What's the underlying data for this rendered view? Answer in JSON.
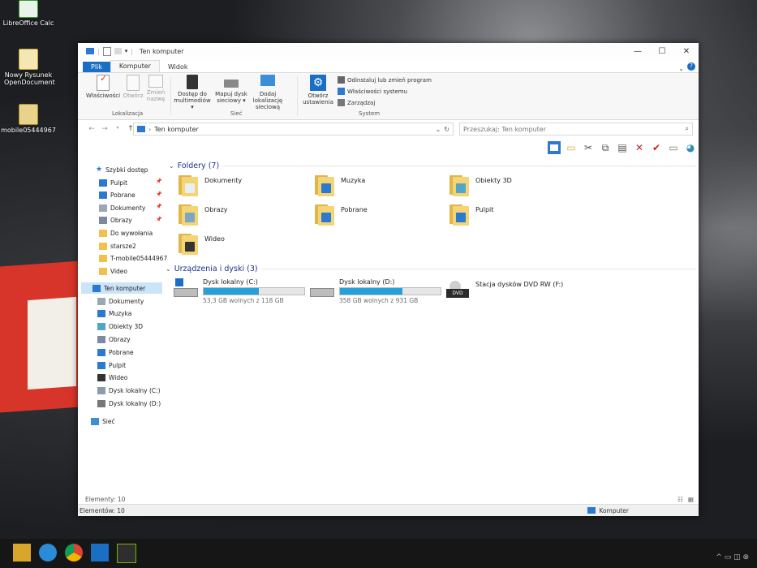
{
  "desktop": {
    "icons": [
      {
        "label": "LibreOffice Calc",
        "icon": "spreadsheet-icon"
      },
      {
        "label": "Nowy Rysunek OpenDocument",
        "icon": "drawing-icon"
      },
      {
        "label": "mobile05444967",
        "icon": "archive-icon"
      }
    ]
  },
  "window": {
    "title": "Ten komputer",
    "tabs": [
      "Plik",
      "Komputer",
      "Widok"
    ],
    "ribbon": {
      "location_group": "Lokalizacja",
      "network_group": "Sieć",
      "system_group": "System",
      "properties": "Właściwości",
      "open": "Otwórz",
      "rename": "Zmień nazwę",
      "media_access": "Dostęp do multimediów",
      "map_drive": "Mapuj dysk sieciowy",
      "add_network_location": "Dodaj lokalizację sieciową",
      "open_settings": "Otwórz ustawienia",
      "uninstall": "Odinstaluj lub zmień program",
      "system_properties": "Właściwości systemu",
      "manage": "Zarządzaj"
    },
    "address": {
      "path": "Ten komputer",
      "search_placeholder": "Przeszukaj: Ten komputer"
    },
    "nav": {
      "quick_access": "Szybki dostęp",
      "quick_items": [
        "Pulpit",
        "Pobrane",
        "Dokumenty",
        "Obrazy",
        "Do wywołania",
        "starsze2",
        "T-mobile05444967",
        "Video"
      ],
      "this_pc": "Ten komputer",
      "pc_items": [
        "Dokumenty",
        "Muzyka",
        "Obiekty 3D",
        "Obrazy",
        "Pobrane",
        "Pulpit",
        "Wideo",
        "Dysk lokalny (C:)",
        "Dysk lokalny (D:)"
      ],
      "network": "Sieć"
    },
    "folders_header": "Foldery (7)",
    "folders": [
      "Dokumenty",
      "Muzyka",
      "Obiekty 3D",
      "Obrazy",
      "Pobrane",
      "Pulpit",
      "Wideo"
    ],
    "devices_header": "Urządzenia i dyski (3)",
    "drives": [
      {
        "name": "Dysk lokalny (C:)",
        "free": "53,3 GB wolnych z 118 GB",
        "used_fraction": 0.55
      },
      {
        "name": "Dysk lokalny (D:)",
        "free": "358 GB wolnych z 931 GB",
        "used_fraction": 0.62
      },
      {
        "name": "Stacja dysków DVD RW (F:)",
        "dvd_label": "DVD"
      }
    ],
    "status_count": "Elementy: 10",
    "status_count2": "Elementów: 10",
    "status_computer": "Komputer"
  },
  "colors": {
    "accent": "#1a6fc4",
    "selection": "#cce4f7",
    "bar_fill": "#26a0da",
    "folder": "#f5d476"
  }
}
